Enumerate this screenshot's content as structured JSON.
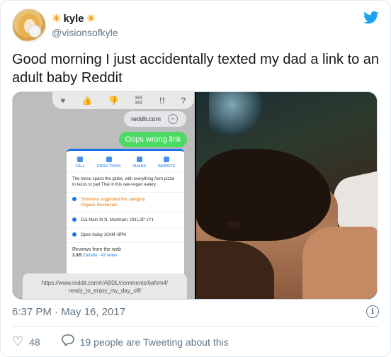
{
  "tweet": {
    "display_name": "kyle",
    "name_decoration": "☀",
    "handle": "@visionsofkyle",
    "text": "Good morning I just accidentally texted my dad a link to an adult baby Reddit",
    "timestamp": "6:37 PM · May 16, 2017",
    "likes": "48",
    "discussion": "19 people are Tweeting about this"
  },
  "media_left": {
    "reactions": [
      "♥",
      "👍",
      "👎",
      "HA HA",
      "!!",
      "?"
    ],
    "link_bubble": "reddit.com",
    "green_bubble": "Oops wrong link",
    "actions": [
      "CALL",
      "DIRECTIONS",
      "SHARE",
      "WEBSITE"
    ],
    "description": "The menu spans the globe, with everything from pizza to tacos to pad Thai in this raw-vegan eatery.",
    "suggested_label": "Someone suggested this category",
    "suggested_value": "Organic Restaurant",
    "address": "115 Main St N, Markham, ON L3P 1Y1",
    "hours": "Open today 10AM–8PM",
    "reviews_heading": "Reviews from the web",
    "review_score": "3.3/5",
    "review_source": "Zomato · 47 votes",
    "url_line1": "https://www.reddit.com/r/ABDL/comments/6afvm4/",
    "url_line2": "ready_to_enjoy_my_day_off/"
  },
  "colors": {
    "twitter_blue": "#1da1f2",
    "imessage_green": "#4cd964",
    "secondary_text": "#657786"
  }
}
